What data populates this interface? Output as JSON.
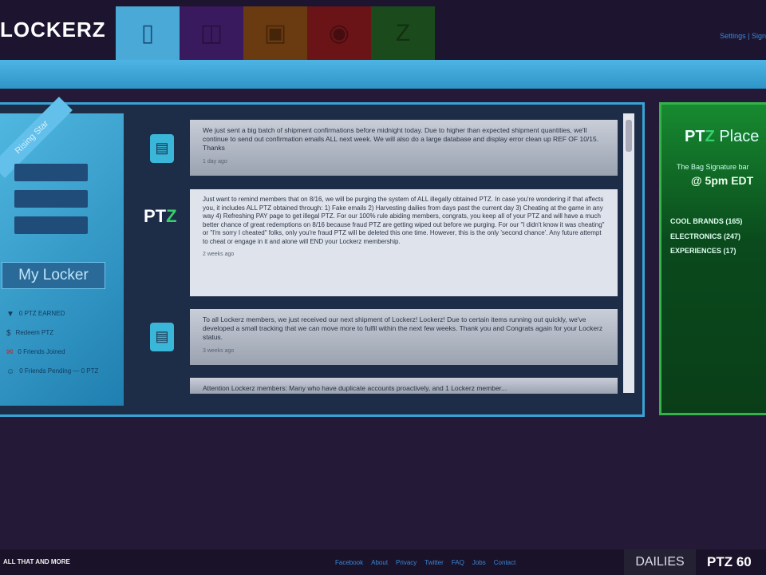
{
  "header": {
    "logo": "LOCKERZ",
    "tabs": [
      {
        "name": "locker",
        "icon": "phone-icon",
        "color": "#4aa9d6",
        "active": true
      },
      {
        "name": "shop",
        "icon": "bag-icon",
        "color": "#3a1a5e"
      },
      {
        "name": "tv",
        "icon": "tv-icon",
        "color": "#6a3a10"
      },
      {
        "name": "lips",
        "icon": "lips-icon",
        "color": "#6a1418"
      },
      {
        "name": "ptz",
        "icon": "ptz-icon",
        "color": "#1b4a1c"
      }
    ],
    "account_links": "Settings | Sign"
  },
  "sidebar": {
    "ribbon": "Rising Star",
    "my_locker": "My Locker",
    "items": [
      {
        "icon": "trophy-icon",
        "text": "0 PTZ EARNED"
      },
      {
        "icon": "dollar-icon",
        "text": "Redeem PTZ"
      },
      {
        "icon": "invite-icon",
        "text": "0 Friends Joined"
      },
      {
        "icon": "friends-icon",
        "text": "0 Friends Pending — 0 PTZ"
      }
    ]
  },
  "feed": {
    "posts": [
      {
        "text": "We just sent a big batch of shipment confirmations before midnight today. Due to higher than expected shipment quantities, we'll continue to send out confirmation emails ALL next week. We will also do a large database and display error clean up REF OF 10/15. Thanks",
        "time": "1 day ago"
      },
      {
        "text": "Just want to remind members that on 8/16, we will be purging the system of ALL illegally obtained PTZ. In case you're wondering if that affects you, it includes ALL PTZ obtained through: 1) Fake emails 2) Harvesting dailies from days past the current day 3) Cheating at the game in any way 4) Refreshing PAY page to get illegal PTZ. For our 100% rule abiding members, congrats, you keep all of your PTZ and will have a much better chance of great redemptions on 8/16 because fraud PTZ are getting wiped out before we purging. For our \"I didn't know it was cheating\" or \"I'm sorry I cheated\" folks, only you're fraud PTZ will be deleted this one time. However, this is the only 'second chance'. Any future attempt to cheat or engage in it and alone will END your Lockerz membership.",
        "time": "2 weeks ago"
      },
      {
        "text": "To all Lockerz members, we just received our next shipment of Lockerz! Lockerz! Due to certain items running out quickly, we've developed a small tracking that we can move more to fulfil within the next few weeks. Thank you and Congrats again for your Lockerz status.",
        "time": "3 weeks ago"
      },
      {
        "text": "Attention Lockerz members: Many who have duplicate accounts proactively, and 1 Lockerz member..."
      }
    ],
    "brand": "PTZ"
  },
  "ptz_panel": {
    "title_pt": "PT",
    "title_z": "Z",
    "title_rest": " Place",
    "subtitle": "The Bag Signature bar",
    "time": "@ 5pm EDT",
    "categories": [
      "COOL BRANDS (165)",
      "ELECTRONICS (247)",
      "EXPERIENCES (17)"
    ]
  },
  "footer": {
    "tagline": "ALL THAT AND MORE",
    "links": [
      "Facebook",
      "About",
      "Privacy",
      "Twitter",
      "FAQ",
      "Jobs",
      "Contact"
    ],
    "dailies": "DAILIES",
    "ptz": "PTZ",
    "count": "60"
  }
}
